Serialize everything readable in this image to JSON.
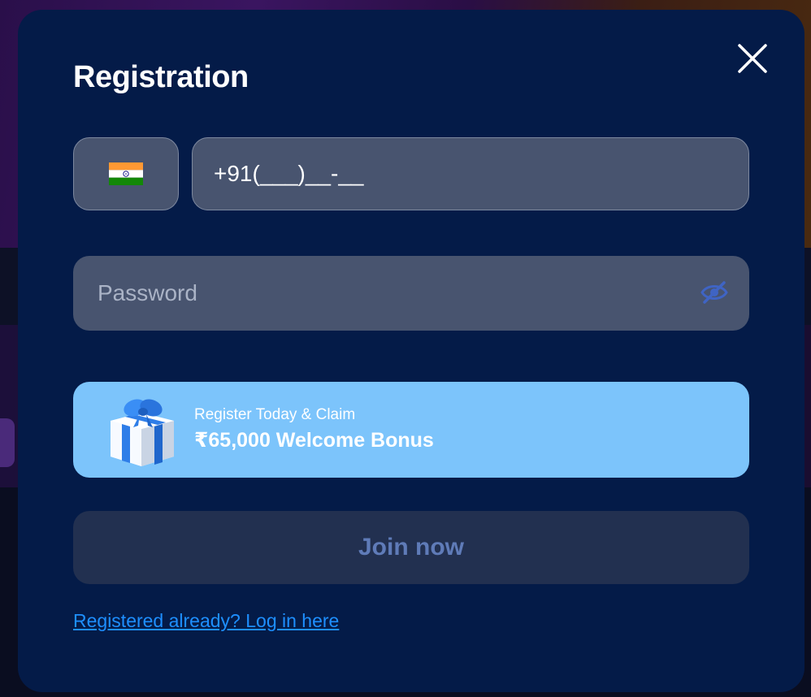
{
  "modal": {
    "title": "Registration",
    "close_icon": "close-icon"
  },
  "phone": {
    "country_flag": "india-flag-icon",
    "mask": "+91(___)__-__"
  },
  "password": {
    "placeholder": "Password",
    "toggle_icon": "eye-slash-icon"
  },
  "bonus": {
    "icon": "gift-icon",
    "line1": "Register Today & Claim",
    "line2": "₹65,000 Welcome Bonus"
  },
  "join": {
    "label": "Join now"
  },
  "login": {
    "text": "Registered already? Log in here"
  },
  "colors": {
    "modal_bg": "#041b48",
    "field_bg": "#48546f",
    "banner_bg": "#7cc4fb",
    "join_bg": "#223050",
    "join_text": "#5f7bb8",
    "link": "#1e8fff"
  }
}
